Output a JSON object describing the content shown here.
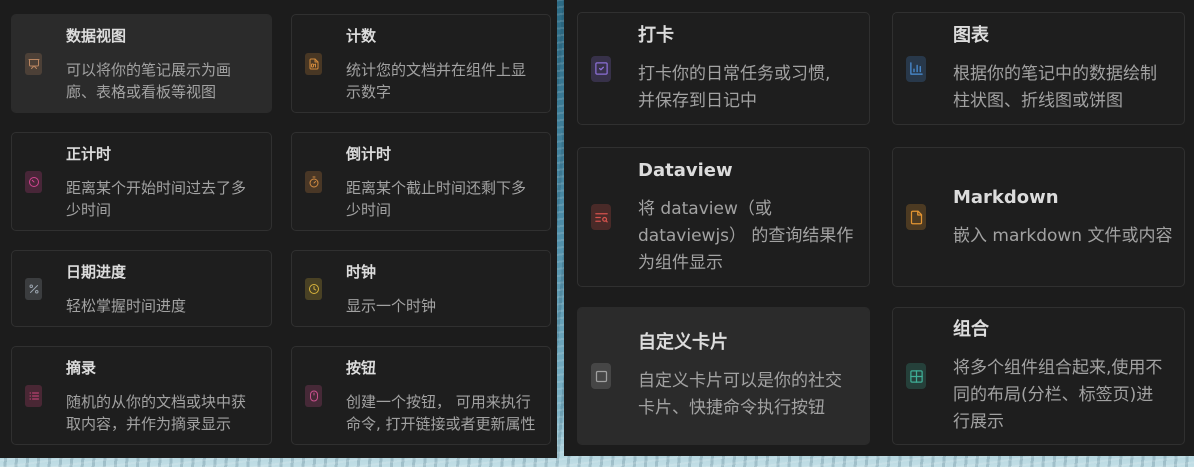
{
  "theme": {
    "panel_bg": "#1c1c1c",
    "card_bg": "#1e1e1e",
    "card_highlight_bg": "#2b2b2b",
    "card_border": "#303030",
    "title_color": "#dcdcdc",
    "desc_color": "#a2a2a2"
  },
  "left_panel": {
    "cards": [
      {
        "title": "数据视图",
        "desc": [
          "可以将你的笔记展示为画",
          "廊、表格或看板等视图"
        ],
        "icon": "presentation-icon",
        "color": "#b98560",
        "highlighted": true
      },
      {
        "title": "计数",
        "desc": [
          "统计您的文档并在组件上显",
          "示数字"
        ],
        "icon": "file-digit-icon",
        "color": "#d38b3c",
        "highlighted": false
      },
      {
        "title": "正计时",
        "desc": [
          "距离某个开始时间过去了多",
          "少时间"
        ],
        "icon": "count-up-timer-icon",
        "color": "#d0448f",
        "highlighted": false
      },
      {
        "title": "倒计时",
        "desc": [
          "距离某个截止时间还剩下多",
          "少时间"
        ],
        "icon": "stopwatch-icon",
        "color": "#d48c42",
        "highlighted": false
      },
      {
        "title": "日期进度",
        "desc": [
          "轻松掌握时间进度"
        ],
        "icon": "percent-icon",
        "color": "#9aa3ad",
        "highlighted": false
      },
      {
        "title": "时钟",
        "desc": [
          "显示一个时钟"
        ],
        "icon": "clock-icon",
        "color": "#d6b23c",
        "highlighted": false
      },
      {
        "title": "摘录",
        "desc": [
          "随机的从你的文档或块中获",
          "取内容，并作为摘录显示"
        ],
        "icon": "list-icon",
        "color": "#d4477e",
        "highlighted": false
      },
      {
        "title": "按钮",
        "desc": [
          "创建一个按钮， 可用来执行",
          "命令, 打开链接或者更新属性"
        ],
        "icon": "mouse-icon",
        "color": "#c8508c",
        "highlighted": false
      }
    ]
  },
  "right_panel": {
    "cards": [
      {
        "title": "打卡",
        "desc": [
          "打卡你的日常任务或习惯,",
          "并保存到日记中"
        ],
        "icon": "check-square-icon",
        "color": "#8b6fd6",
        "highlighted": false
      },
      {
        "title": "图表",
        "desc": [
          "根据你的笔记中的数据绘制",
          "柱状图、折线图或饼图"
        ],
        "icon": "bar-chart-icon",
        "color": "#4a8fd8",
        "highlighted": false
      },
      {
        "title": "Dataview",
        "desc": [
          "将 dataview（或",
          "dataviewjs） 的查询结果作",
          "为组件显示"
        ],
        "icon": "list-search-icon",
        "color": "#d4524c",
        "highlighted": false
      },
      {
        "title": "Markdown",
        "desc": [
          "嵌入 markdown 文件或内容"
        ],
        "icon": "file-icon",
        "color": "#e39532",
        "highlighted": false
      },
      {
        "title": "自定义卡片",
        "desc": [
          "自定义卡片可以是你的社交",
          "卡片、快捷命令执行按钮"
        ],
        "icon": "square-icon",
        "color": "#a0a0a0",
        "highlighted": true
      },
      {
        "title": "组合",
        "desc": [
          "将多个组件组合起来,使用不",
          "同的布局(分栏、标签页)进",
          "行展示"
        ],
        "icon": "layout-grid-icon",
        "color": "#3fae96",
        "highlighted": false
      }
    ]
  }
}
